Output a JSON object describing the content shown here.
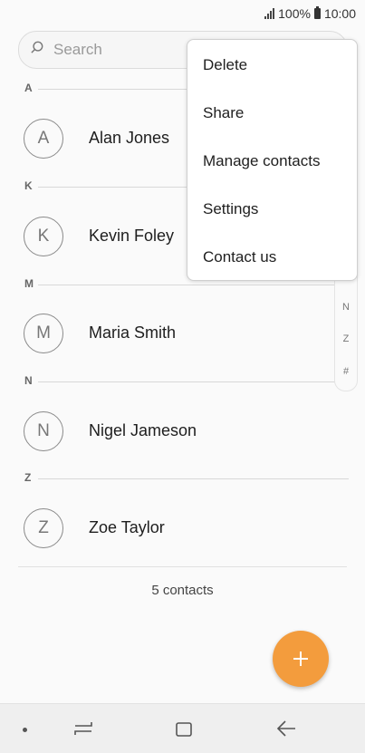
{
  "status": {
    "battery": "100%",
    "time": "10:00"
  },
  "search": {
    "placeholder": "Search"
  },
  "sections": [
    {
      "letter": "A",
      "contact": {
        "initial": "A",
        "name": "Alan Jones"
      }
    },
    {
      "letter": "K",
      "contact": {
        "initial": "K",
        "name": "Kevin Foley"
      }
    },
    {
      "letter": "M",
      "contact": {
        "initial": "M",
        "name": "Maria Smith"
      }
    },
    {
      "letter": "N",
      "contact": {
        "initial": "N",
        "name": "Nigel Jameson"
      }
    },
    {
      "letter": "Z",
      "contact": {
        "initial": "Z",
        "name": "Zoe Taylor"
      }
    }
  ],
  "footer": {
    "count": "5 contacts"
  },
  "fast_scroll": [
    "N",
    "Z",
    "#"
  ],
  "menu": {
    "items": [
      "Delete",
      "Share",
      "Manage contacts",
      "Settings",
      "Contact us"
    ]
  },
  "colors": {
    "accent": "#f39c3d"
  },
  "icons": [
    "search-icon",
    "signal-icon",
    "battery-icon",
    "add-icon",
    "recent-apps-icon",
    "home-icon",
    "back-icon"
  ]
}
